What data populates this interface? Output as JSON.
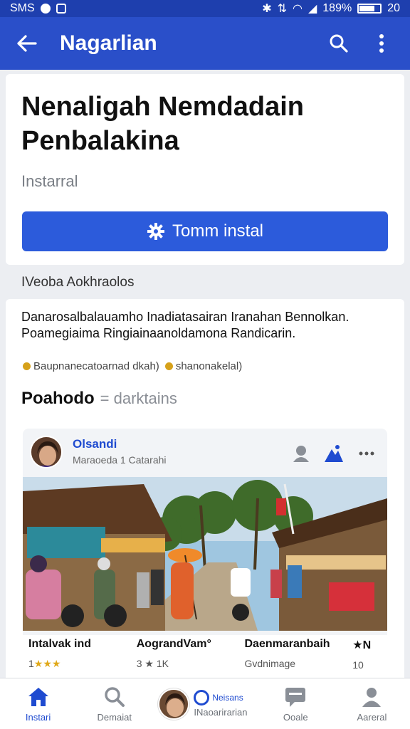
{
  "status_bar": {
    "left_text": "SMS",
    "right_text": "189%",
    "time": "20",
    "battery_level": 0.7
  },
  "app_bar": {
    "title": "Nagarlian"
  },
  "app_card": {
    "title": "Nenaligah Nemdadain Penbalakina",
    "status": "Instarral",
    "install_label": "Tomm instal"
  },
  "section_label": "IVeoba Aokhraolos",
  "content": {
    "description": "Danarosalbalauamho Inadiatasairan Iranahan Bennolkan. Poamegiaima Ringiainaanoldamona Randicarin.",
    "tags": [
      "Baupnanecatoarnad dkah)",
      "shanonakelal)"
    ],
    "subhead": "Poahodo",
    "subhead_sub": "= darktains"
  },
  "post": {
    "author": "Olsandi",
    "meta": "Maraoeda 1 Catarahi",
    "items": [
      {
        "name": "Intalvak ind",
        "stat": "1",
        "stars": "★★★"
      },
      {
        "name": "AograndVam°",
        "stat": "3 ★ 1K",
        "stars": ""
      },
      {
        "name": "Daenmaranbaih",
        "stat": "Gvdnimage",
        "stars": ""
      },
      {
        "name": "★N",
        "stat": "10",
        "stars": ""
      }
    ]
  },
  "bottom_nav": {
    "items": [
      {
        "label": "Instari"
      },
      {
        "label": "Demaiat"
      },
      {
        "label": "Ooale"
      },
      {
        "label": "Aareral"
      }
    ],
    "center_pill": "Neisans",
    "center_label": "INaoarirarian"
  },
  "colors": {
    "primary": "#2a4fc9",
    "button": "#2c5bdb",
    "star": "#e0a818"
  }
}
